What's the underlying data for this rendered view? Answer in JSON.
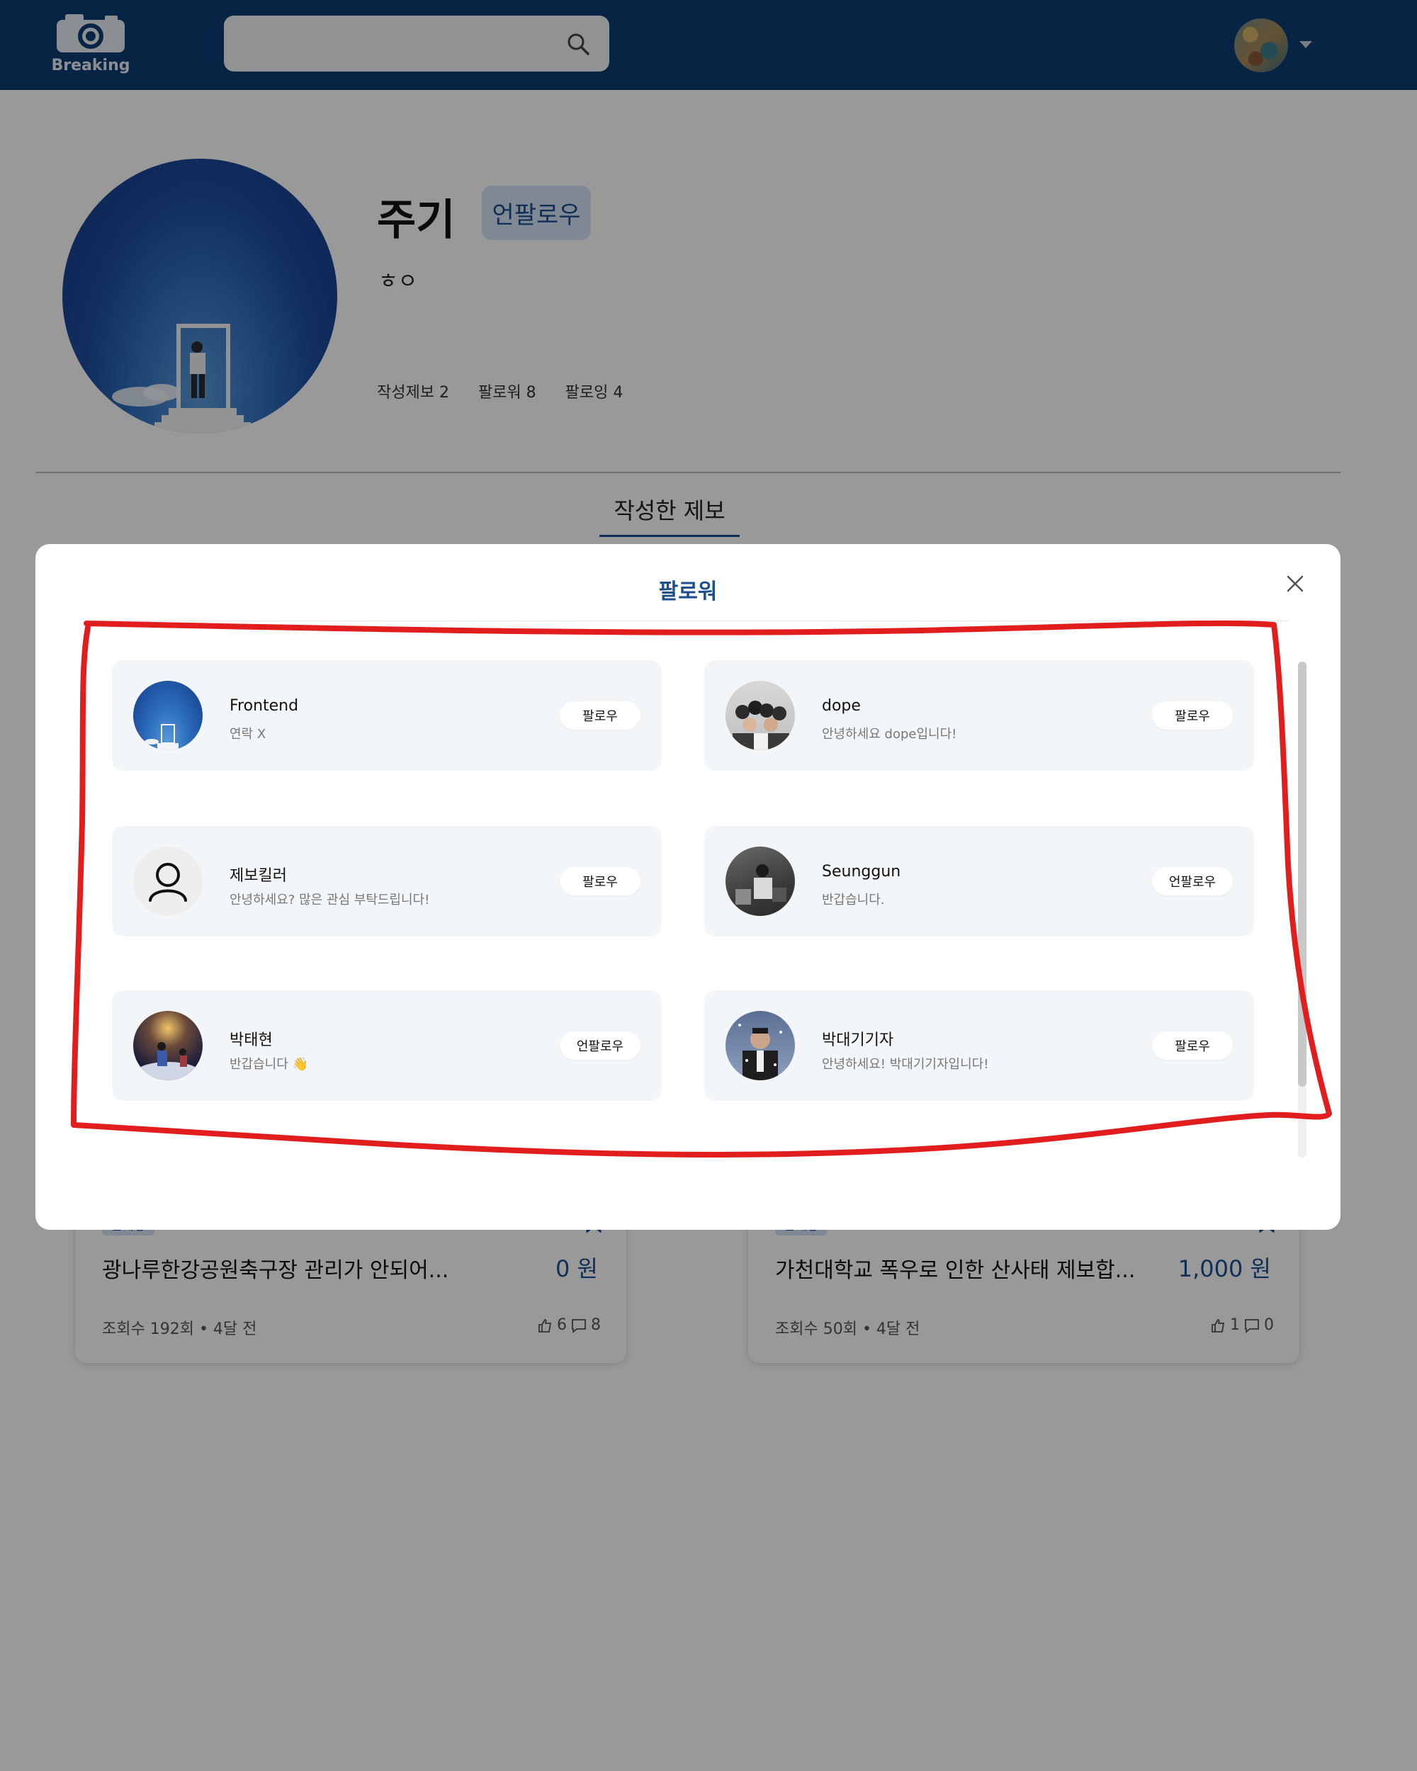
{
  "header": {
    "logo_text": "Breaking",
    "search": {
      "placeholder": "",
      "value": ""
    }
  },
  "profile": {
    "name": "주기",
    "unfollow_label": "언팔로우",
    "bio": "ㅎㅇ",
    "stats": {
      "posts": "작성제보 2",
      "followers": "팔로워 8",
      "following": "팔로잉 4"
    },
    "tab_label": "작성한 제보"
  },
  "posts": [
    {
      "badge": "판매중",
      "title": "광나루한강공원축구장 관리가 안되어...",
      "price": "0 원",
      "meta": "조회수 192회 • 4달 전",
      "likes": "6",
      "comments": "8"
    },
    {
      "badge": "판매중",
      "title": "가천대학교 폭우로 인한 산사태 제보합...",
      "price": "1,000 원",
      "meta": "조회수 50회 • 4달 전",
      "likes": "1",
      "comments": "0"
    }
  ],
  "modal": {
    "title": "팔로워",
    "followers": [
      {
        "name": "Frontend",
        "desc": "연락 X",
        "button": "팔로우",
        "avatar": "blue-sky-photo"
      },
      {
        "name": "dope",
        "desc": "안녕하세요 dope입니다!",
        "button": "팔로우",
        "avatar": "group-photo"
      },
      {
        "name": "제보킬러",
        "desc": "안녕하세요? 많은 관심 부탁드립니다!",
        "button": "팔로우",
        "avatar": "default-user-icon"
      },
      {
        "name": "Seunggun",
        "desc": "반갑습니다.",
        "button": "언팔로우",
        "avatar": "dark-photo"
      },
      {
        "name": "박태현",
        "desc": "반갑습니다 👋",
        "button": "언팔로우",
        "avatar": "night-photo"
      },
      {
        "name": "박대기기자",
        "desc": "안녕하세요! 박대기기자입니다!",
        "button": "팔로우",
        "avatar": "snow-reporter-photo"
      }
    ]
  },
  "colors": {
    "header": "#0d3c73",
    "accent": "#1d4f8f",
    "annotation": "#e21d1d",
    "card": "#f3f6f9"
  }
}
